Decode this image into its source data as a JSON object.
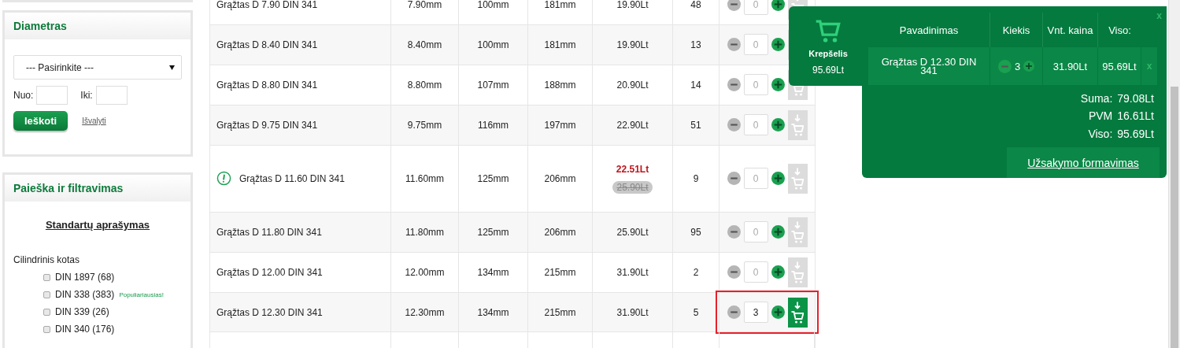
{
  "sidebar": {
    "diameter_panel": {
      "title": "Diametras",
      "select_value": "--- Pasirinkite ---",
      "from_label": "Nuo:",
      "to_label": "Iki:",
      "search_button": "Ieškoti",
      "clear_link": "Išvalyti"
    },
    "filter_panel": {
      "title": "Paieška ir filtravimas",
      "standards_link": "Standartų aprašymas",
      "group_label": "Cilindrinis kotas",
      "options": [
        {
          "label": "DIN 1897 (68)",
          "checked": false
        },
        {
          "label": "DIN 338 (383)",
          "checked": false,
          "badge": "Populiariausias!"
        },
        {
          "label": "DIN 339 (26)",
          "checked": false
        },
        {
          "label": "DIN 340 (176)",
          "checked": false
        }
      ]
    }
  },
  "products": [
    {
      "name": "Grąžtas D 7.90 DIN 341",
      "diameter": "7.90mm",
      "length": "100mm",
      "total_length": "181mm",
      "price": "19.90Lt",
      "stock": "48",
      "quantity": "0",
      "warning": false,
      "in_cart": false,
      "highlighted": false
    },
    {
      "name": "Grąžtas D 8.40 DIN 341",
      "diameter": "8.40mm",
      "length": "100mm",
      "total_length": "181mm",
      "price": "19.90Lt",
      "stock": "13",
      "quantity": "0",
      "warning": false,
      "in_cart": false,
      "highlighted": false
    },
    {
      "name": "Grąžtas D 8.80 DIN 341",
      "diameter": "8.80mm",
      "length": "107mm",
      "total_length": "188mm",
      "price": "20.90Lt",
      "stock": "14",
      "quantity": "0",
      "warning": false,
      "in_cart": false,
      "highlighted": false
    },
    {
      "name": "Grąžtas D 9.75 DIN 341",
      "diameter": "9.75mm",
      "length": "116mm",
      "total_length": "197mm",
      "price": "22.90Lt",
      "stock": "51",
      "quantity": "0",
      "warning": false,
      "in_cart": false,
      "highlighted": false
    },
    {
      "name": "Grąžtas D 11.60 DIN 341",
      "diameter": "11.60mm",
      "length": "125mm",
      "total_length": "206mm",
      "price": "22.51Lt",
      "old_price": "25.90Lt",
      "stock": "9",
      "quantity": "0",
      "warning": true,
      "in_cart": false,
      "highlighted": false
    },
    {
      "name": "Grąžtas D 11.80 DIN 341",
      "diameter": "11.80mm",
      "length": "125mm",
      "total_length": "206mm",
      "price": "25.90Lt",
      "stock": "95",
      "quantity": "0",
      "warning": false,
      "in_cart": false,
      "highlighted": false
    },
    {
      "name": "Grąžtas D 12.00 DIN 341",
      "diameter": "12.00mm",
      "length": "134mm",
      "total_length": "215mm",
      "price": "31.90Lt",
      "stock": "2",
      "quantity": "0",
      "warning": false,
      "in_cart": false,
      "highlighted": false
    },
    {
      "name": "Grąžtas D 12.30 DIN 341",
      "diameter": "12.30mm",
      "length": "134mm",
      "total_length": "215mm",
      "price": "31.90Lt",
      "stock": "5",
      "quantity": "3",
      "warning": false,
      "in_cart": true,
      "highlighted": true
    }
  ],
  "cart": {
    "label": "Krepšelis",
    "total": "95.69Lt",
    "columns": [
      "Pavadinimas",
      "Kiekis",
      "Vnt. kaina",
      "Viso:"
    ],
    "items": [
      {
        "name": "Grąžtas D 12.30 DIN 341",
        "quantity": "3",
        "unit_price": "31.90Lt",
        "total": "95.69Lt",
        "remove": "x"
      }
    ],
    "summary": [
      {
        "label": "Suma:",
        "value": "79.08Lt"
      },
      {
        "label": "PVM",
        "value": "16.61Lt"
      },
      {
        "label": "Viso:",
        "value": "95.69Lt"
      }
    ],
    "checkout_link": "Užsakymo formavimas",
    "close": "x"
  }
}
